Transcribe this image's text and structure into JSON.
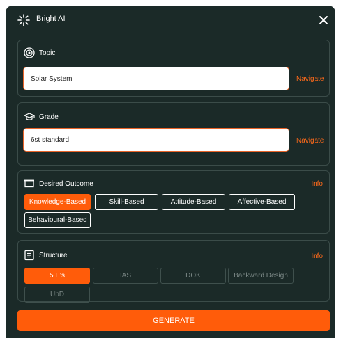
{
  "header": {
    "title": "Bright AI"
  },
  "topic": {
    "label": "Topic",
    "value": "Solar System",
    "action": "Navigate"
  },
  "grade": {
    "label": "Grade",
    "value": "6st standard",
    "action": "Navigate"
  },
  "outcome": {
    "label": "Desired Outcome",
    "info": "Info",
    "options": [
      "Knowledge-Based",
      "Skill-Based",
      "Attitude-Based",
      "Affective-Based",
      "Behavioural-Based"
    ],
    "selected": "Knowledge-Based"
  },
  "structure": {
    "label": "Structure",
    "info": "Info",
    "options": [
      "5 E's",
      "IAS",
      "DOK",
      "Backward Design",
      "UbD"
    ],
    "selected": "5 E's"
  },
  "generate_label": "GENERATE",
  "colors": {
    "accent": "#ff5c0a",
    "panel": "#1b2a28",
    "border": "#3b4c49"
  }
}
